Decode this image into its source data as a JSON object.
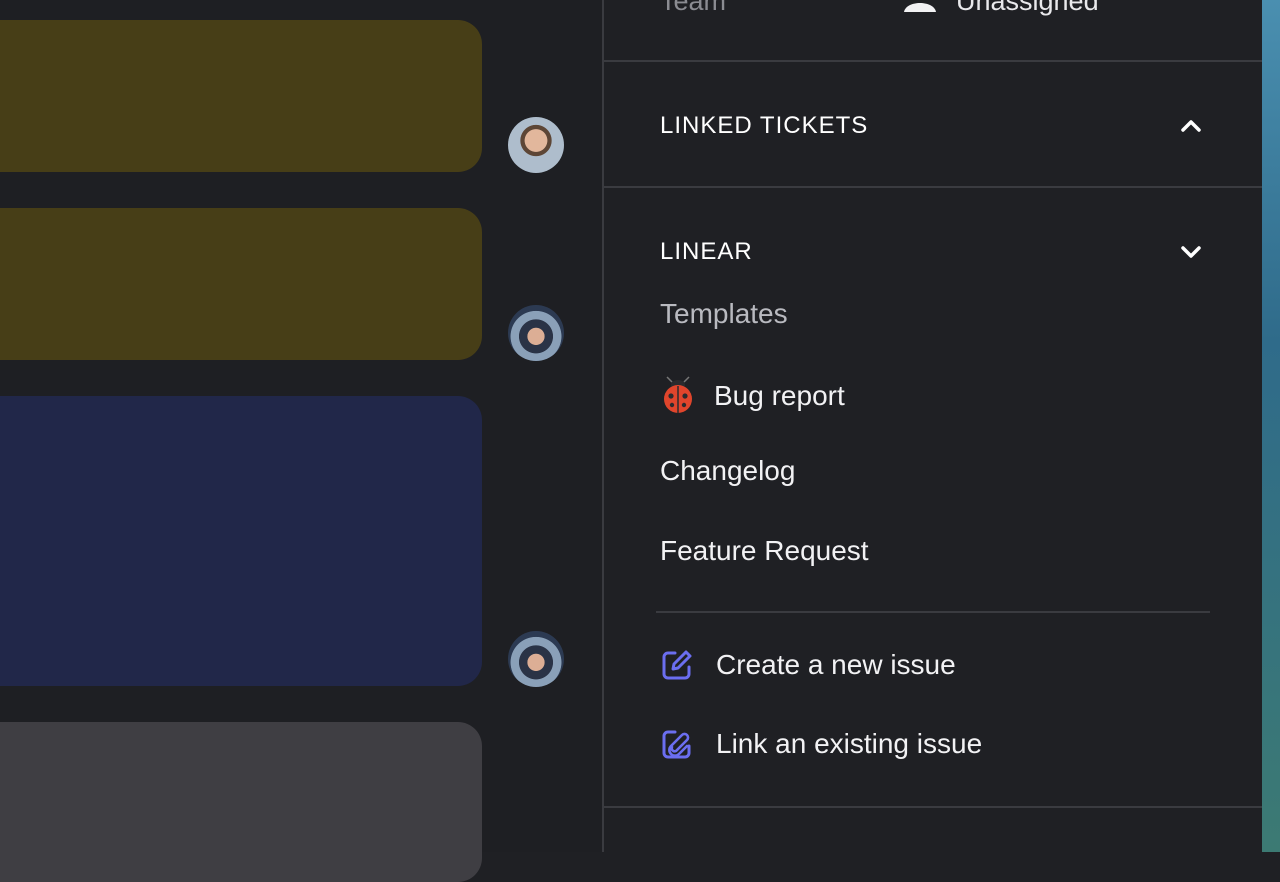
{
  "panel": {
    "team": {
      "label": "Team",
      "value": "Unassigned",
      "icon": "person-icon"
    },
    "linked_tickets": {
      "label": "LINKED TICKETS",
      "icon": "chevron-up-icon"
    },
    "linear": {
      "label": "LINEAR",
      "icon": "chevron-down-icon",
      "templates_label": "Templates",
      "templates": [
        {
          "label": "Bug report",
          "icon": "ladybug-icon"
        },
        {
          "label": "Changelog"
        },
        {
          "label": "Feature Request"
        }
      ],
      "actions": [
        {
          "label": "Create a new issue",
          "icon": "edit-icon"
        },
        {
          "label": "Link an existing issue",
          "icon": "link-edit-icon"
        }
      ]
    }
  },
  "colors": {
    "accent": "#6b6ef0",
    "panel_bg": "#1f2024",
    "bubble_yellow": "#473e17",
    "bubble_blue": "#212749",
    "bubble_gray": "#3f3e43"
  }
}
